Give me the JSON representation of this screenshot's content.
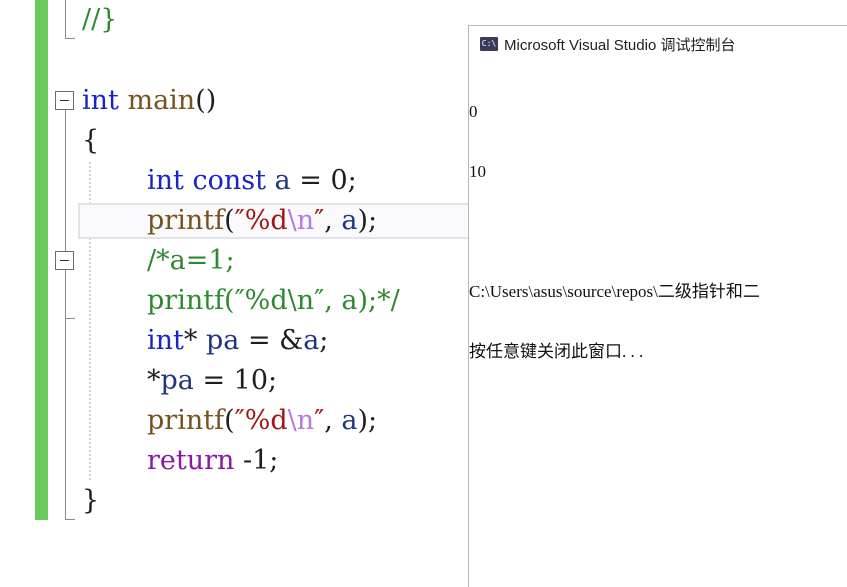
{
  "editor": {
    "lines": [
      {
        "id": "line-0",
        "tokens": [
          {
            "cls": "tok-cmt",
            "text": "//}"
          }
        ]
      },
      {
        "id": "line-blank",
        "tokens": []
      },
      {
        "id": "line-main",
        "tokens": [
          {
            "cls": "tok-kw",
            "text": "int"
          },
          {
            "cls": "",
            "text": " "
          },
          {
            "cls": "tok-fn",
            "text": "main"
          },
          {
            "cls": "",
            "text": "()"
          }
        ]
      },
      {
        "id": "line-open-brace",
        "tokens": [
          {
            "cls": "",
            "text": "{"
          }
        ]
      },
      {
        "id": "line-const",
        "tokens": [
          {
            "cls": "tok-kw",
            "text": "int"
          },
          {
            "cls": "",
            "text": " "
          },
          {
            "cls": "tok-kw",
            "text": "const"
          },
          {
            "cls": "",
            "text": " "
          },
          {
            "cls": "tok-var",
            "text": "a"
          },
          {
            "cls": "",
            "text": " = 0;"
          }
        ]
      },
      {
        "id": "line-printf-1",
        "tokens": [
          {
            "cls": "tok-fn",
            "text": "printf"
          },
          {
            "cls": "",
            "text": "("
          },
          {
            "cls": "tok-str",
            "text": "″%d"
          },
          {
            "cls": "tok-esc",
            "text": "\\n"
          },
          {
            "cls": "tok-str",
            "text": "″"
          },
          {
            "cls": "",
            "text": ", "
          },
          {
            "cls": "tok-var",
            "text": "a"
          },
          {
            "cls": "",
            "text": ");"
          }
        ]
      },
      {
        "id": "line-comment-1",
        "tokens": [
          {
            "cls": "tok-cmt",
            "text": "/*a=1;"
          }
        ]
      },
      {
        "id": "line-comment-2",
        "tokens": [
          {
            "cls": "tok-cmt",
            "text": "printf(″%d\\n″, a);*/"
          }
        ]
      },
      {
        "id": "line-pointer-decl",
        "tokens": [
          {
            "cls": "tok-kw",
            "text": "int"
          },
          {
            "cls": "",
            "text": "* "
          },
          {
            "cls": "tok-var",
            "text": "pa"
          },
          {
            "cls": "",
            "text": " = &"
          },
          {
            "cls": "tok-var",
            "text": "a"
          },
          {
            "cls": "",
            "text": ";"
          }
        ]
      },
      {
        "id": "line-pointer-assign",
        "tokens": [
          {
            "cls": "",
            "text": "*"
          },
          {
            "cls": "tok-var",
            "text": "pa"
          },
          {
            "cls": "",
            "text": " = 10;"
          }
        ]
      },
      {
        "id": "line-printf-2",
        "tokens": [
          {
            "cls": "tok-fn",
            "text": "printf"
          },
          {
            "cls": "",
            "text": "("
          },
          {
            "cls": "tok-str",
            "text": "″%d"
          },
          {
            "cls": "tok-esc",
            "text": "\\n"
          },
          {
            "cls": "tok-str",
            "text": "″"
          },
          {
            "cls": "",
            "text": ", "
          },
          {
            "cls": "tok-var",
            "text": "a"
          },
          {
            "cls": "",
            "text": ");"
          }
        ]
      },
      {
        "id": "line-return",
        "tokens": [
          {
            "cls": "tok-kw2",
            "text": "return"
          },
          {
            "cls": "",
            "text": " -1;"
          }
        ]
      },
      {
        "id": "line-close-brace",
        "tokens": [
          {
            "cls": "",
            "text": "}"
          }
        ]
      }
    ]
  },
  "console": {
    "icon_text": "C:\\",
    "title": "Microsoft Visual Studio 调试控制台",
    "output": [
      "0",
      "10",
      "",
      "C:\\Users\\asus\\source\\repos\\二级指针和二",
      "按任意键关闭此窗口. . ."
    ]
  },
  "colors": {
    "change_bar": "#6ccb5f",
    "keyword": "#1a22c8",
    "control_keyword": "#8a1aa6",
    "function": "#74531f",
    "string": "#a31515",
    "escape": "#b77ae0",
    "variable": "#1f377f",
    "comment": "#2c8a2c"
  }
}
